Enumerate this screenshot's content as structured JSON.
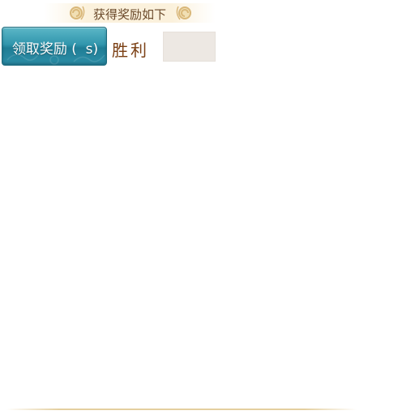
{
  "banner": {
    "title": "获得奖励如下"
  },
  "claim_button": {
    "label": "领取奖励 (  s)"
  },
  "result": {
    "label": "胜利"
  },
  "reward_slots": [
    {
      "empty": true
    }
  ],
  "colors": {
    "button_teal": "#2f93ab",
    "banner_text": "#6b4a2b",
    "result_text": "#7a3e12",
    "gold_accent": "#d9b779",
    "slot_bg": "#ede8e3"
  },
  "icons": {
    "banner_left_ornament": "cloud-swirl-icon",
    "banner_right_ornament": "cloud-swirl-icon"
  }
}
